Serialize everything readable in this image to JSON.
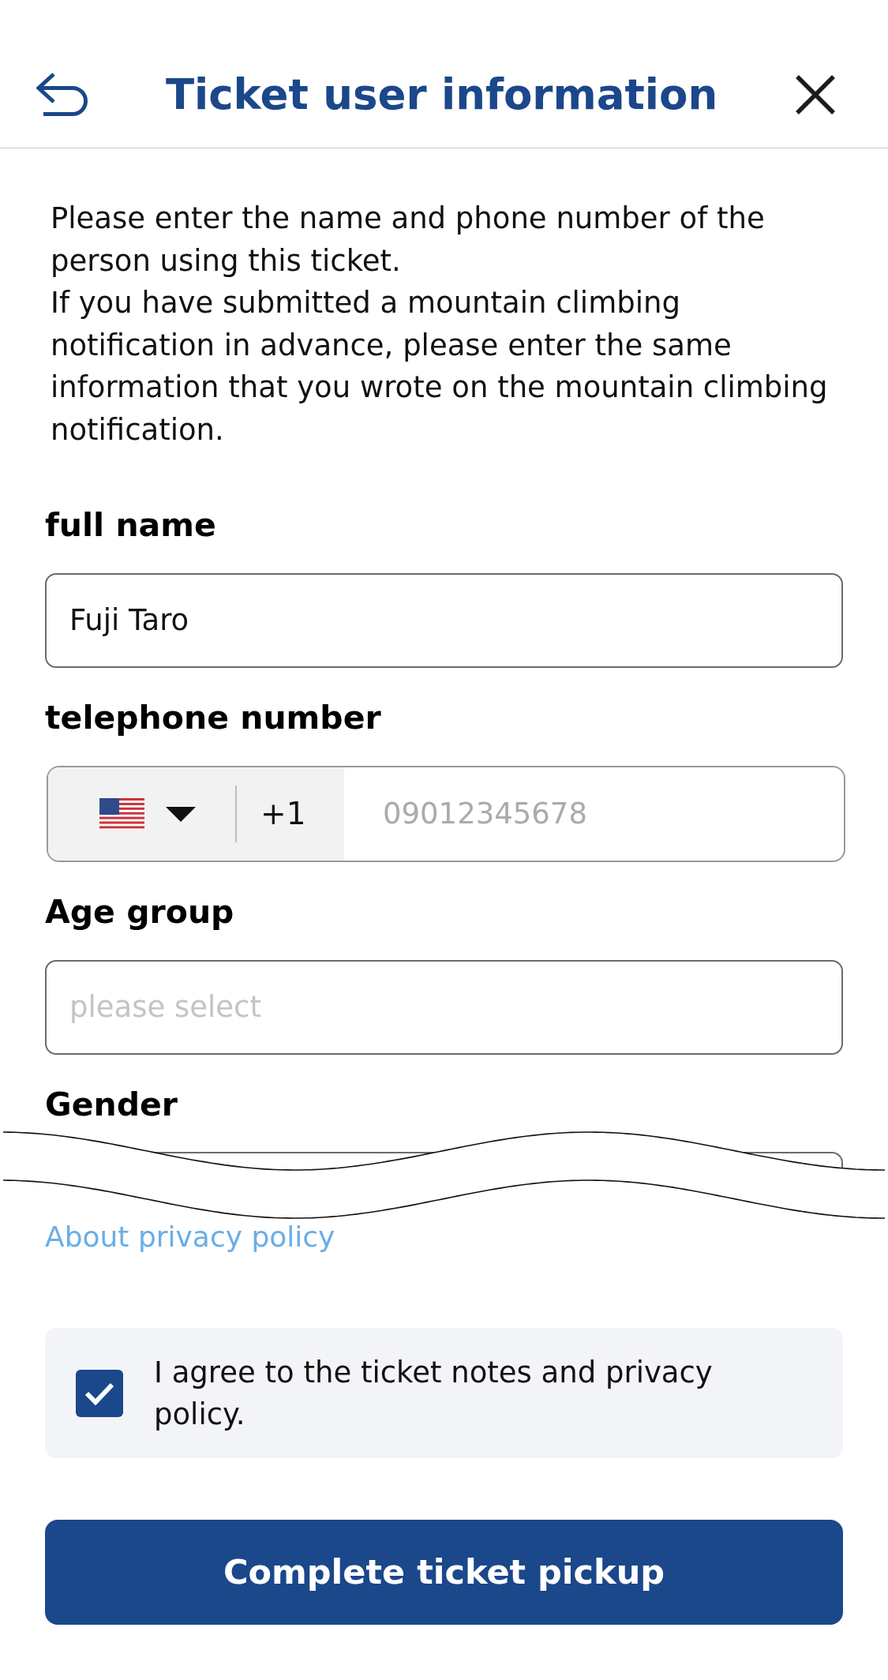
{
  "header": {
    "title": "Ticket user information"
  },
  "intro": [
    "Please enter the name and phone number of the person using this ticket.",
    "If you have submitted a mountain climbing notification in advance, please enter the same information that you wrote on the mountain climbing notification."
  ],
  "fields": [
    {
      "kind": "text",
      "label": "full name",
      "value": "Fuji Taro"
    },
    {
      "kind": "phone",
      "label": "telephone number",
      "country_code": "+1",
      "placeholder": "09012345678"
    },
    {
      "kind": "select",
      "label": "Age group",
      "placeholder": "please select"
    },
    {
      "kind": "select",
      "label": "Gender",
      "cut": true
    }
  ],
  "privacy_link": "About privacy policy",
  "agreement": {
    "checked": true,
    "text": "I agree to the ticket notes and privacy policy."
  },
  "submit_button": "Complete ticket pickup"
}
